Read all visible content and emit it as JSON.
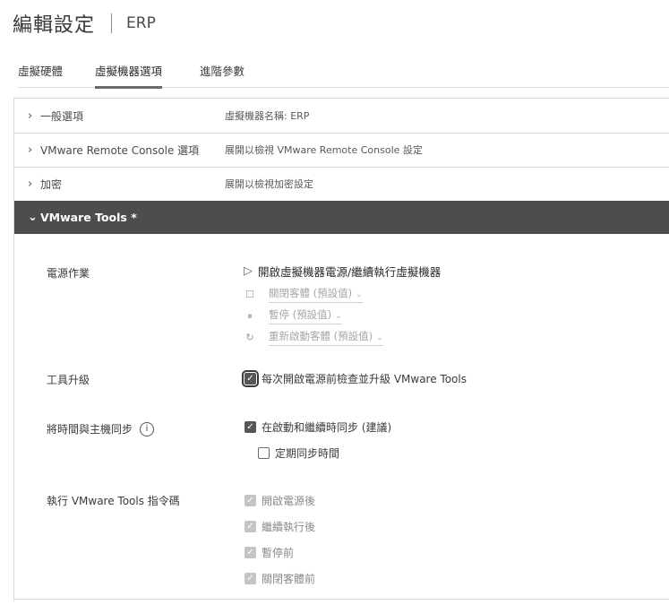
{
  "header": {
    "title": "編輯設定",
    "subtitle": "ERP"
  },
  "tabs": [
    {
      "label": "虛擬硬體"
    },
    {
      "label": "虛擬機器選項"
    },
    {
      "label": "進階參數"
    }
  ],
  "rows": [
    {
      "label": "一般選項",
      "value": "虛擬機器名稱: ERP"
    },
    {
      "label": "VMware Remote Console 選項",
      "value": "展開以檢視 VMware Remote Console 設定"
    },
    {
      "label": "加密",
      "value": "展開以檢視加密設定"
    }
  ],
  "vmware_tools": {
    "header": "VMware Tools *",
    "power_ops": {
      "label": "電源作業",
      "primary": "開啟虛擬機器電源/繼續執行虛擬機器",
      "stop": "關閉客體 (預設值)",
      "suspend": "暫停 (預設值)",
      "restart": "重新啟動客體 (預設值)"
    },
    "upgrade": {
      "label": "工具升級",
      "checkbox": "每次開啟電源前檢查並升級 VMware Tools"
    },
    "time_sync": {
      "label": "將時間與主機同步",
      "info_icon": "i",
      "on_startup": "在啟動和繼續時同步 (建議)",
      "periodic": "定期同步時間"
    },
    "scripts": {
      "label": "執行 VMware Tools 指令碼",
      "items": [
        "開啟電源後",
        "繼續執行後",
        "暫停前",
        "關閉客體前"
      ]
    }
  },
  "icons": {
    "chevron_right": "›",
    "chevron_down": "⌄",
    "play": "▷",
    "stop": "☐",
    "pause": "⏸",
    "restart": "↻",
    "caret": "⌄",
    "check": "✓"
  }
}
